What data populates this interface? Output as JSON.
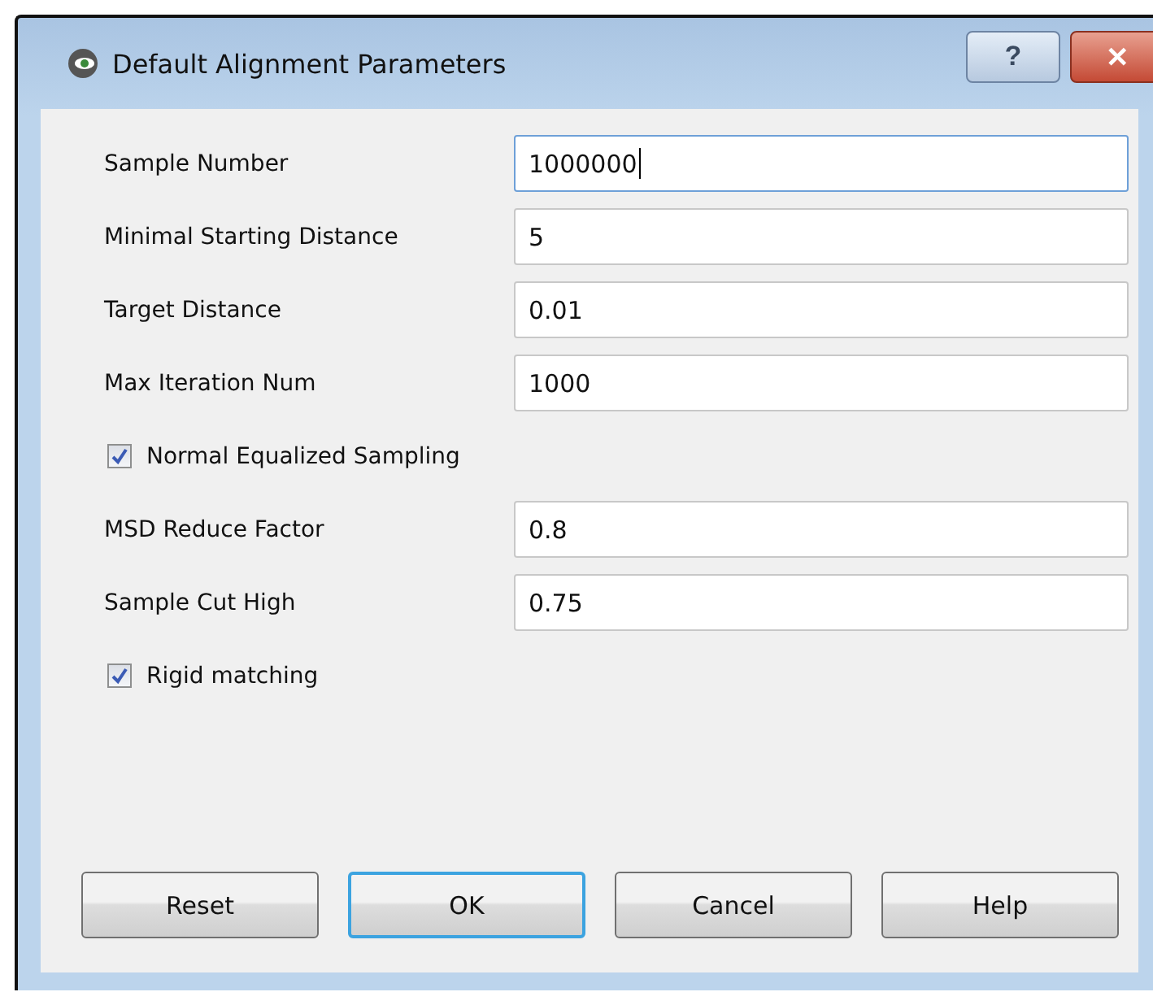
{
  "window": {
    "title": "Default Alignment Parameters",
    "buttons": [
      "?",
      "✕"
    ]
  },
  "rows": [
    {
      "kind": "field",
      "label": "Sample Number",
      "value": "1000000",
      "focused": true
    },
    {
      "kind": "field",
      "label": "Minimal Starting Distance",
      "value": "5",
      "focused": false
    },
    {
      "kind": "field",
      "label": "Target Distance",
      "value": "0.01",
      "focused": false
    },
    {
      "kind": "field",
      "label": "Max Iteration Num",
      "value": "1000",
      "focused": false
    },
    {
      "kind": "checkbox",
      "label": "Normal Equalized Sampling",
      "checked": true
    },
    {
      "kind": "field",
      "label": "MSD Reduce Factor",
      "value": "0.8",
      "focused": false
    },
    {
      "kind": "field",
      "label": "Sample Cut High",
      "value": "0.75",
      "focused": false
    },
    {
      "kind": "checkbox",
      "label": "Rigid matching",
      "checked": true
    }
  ],
  "buttons": [
    {
      "label": "Reset",
      "default": false
    },
    {
      "label": "OK",
      "default": true
    },
    {
      "label": "Cancel",
      "default": false
    },
    {
      "label": "Help",
      "default": false
    }
  ]
}
